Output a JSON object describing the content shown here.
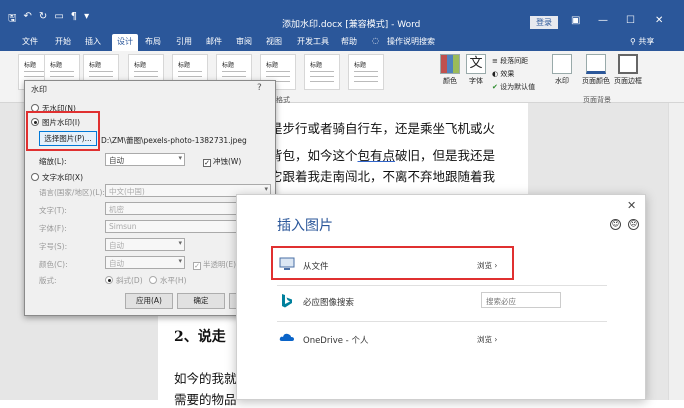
{
  "titlebar": {
    "title": "添加水印.docx [兼容模式] - Word",
    "login": "登录",
    "restore_icon": "ribbon-display-icon",
    "min": "—",
    "max": "☐",
    "close": "✕"
  },
  "tabs": [
    "文件",
    "开始",
    "插入",
    "设计",
    "布局",
    "引用",
    "邮件",
    "审阅",
    "视图",
    "开发工具",
    "帮助",
    "操作说明搜索"
  ],
  "active_tab": "设计",
  "share": "共享",
  "ribbon": {
    "style_thumbs": [
      "标题",
      "标题",
      "标题",
      "标题",
      "标题",
      "标题",
      "标题",
      "标题",
      "标题"
    ],
    "colors": "颜色",
    "fonts": "字体",
    "para_spacing": "段落间距",
    "effects": "效果",
    "set_default": "设为默认值",
    "watermark": "水印",
    "page_color": "页面颜色",
    "page_border": "页面边框",
    "group_page_bg": "页面背景",
    "group_format": "格式"
  },
  "document": {
    "lines": [
      "是步行或者骑自行车，还是乘坐飞机或火",
      "背包，如今这个包有点破旧，但是我还是",
      "它跟着我走南闯北，不离不弃地跟随着我"
    ],
    "underlined": "包有点",
    "heading": "2、说走",
    "line4": "如今的我就",
    "line5": "需要的物品"
  },
  "watermark_dialog": {
    "title": "水印",
    "help": "?",
    "no_watermark": "无水印(N)",
    "picture_watermark": "图片水印(I)",
    "select_picture": "选择图片(P)...",
    "picture_path": "D:\\ZM\\蕾图\\pexels-photo-1382731.jpeg",
    "scale_label": "缩放(L):",
    "scale_value": "自动",
    "washout": "冲蚀(W)",
    "text_watermark": "文字水印(X)",
    "language_label": "语言(国家/地区)(L):",
    "language_value": "中文(中国)",
    "text_label": "文字(T):",
    "text_value": "机密",
    "font_label": "字体(F):",
    "font_value": "Simsun",
    "size_label": "字号(S):",
    "size_value": "自动",
    "color_label": "颜色(C):",
    "color_value": "自动",
    "semitransparent": "半透明(E)",
    "layout_label": "版式:",
    "diagonal": "斜式(D)",
    "horizontal": "水平(H)",
    "apply": "应用(A)",
    "ok": "确定"
  },
  "insert_picture": {
    "title": "插入图片",
    "close": "✕",
    "rows": [
      {
        "label": "从文件",
        "action": "浏览 ›",
        "icon": "computer-icon"
      },
      {
        "label": "必应图像搜索",
        "action": "搜索必应",
        "icon": "bing-icon"
      },
      {
        "label": "OneDrive - 个人",
        "action": "浏览 ›",
        "icon": "onedrive-icon"
      }
    ]
  },
  "colors": {
    "brand": "#2b579a",
    "highlight_border": "#e03030"
  }
}
